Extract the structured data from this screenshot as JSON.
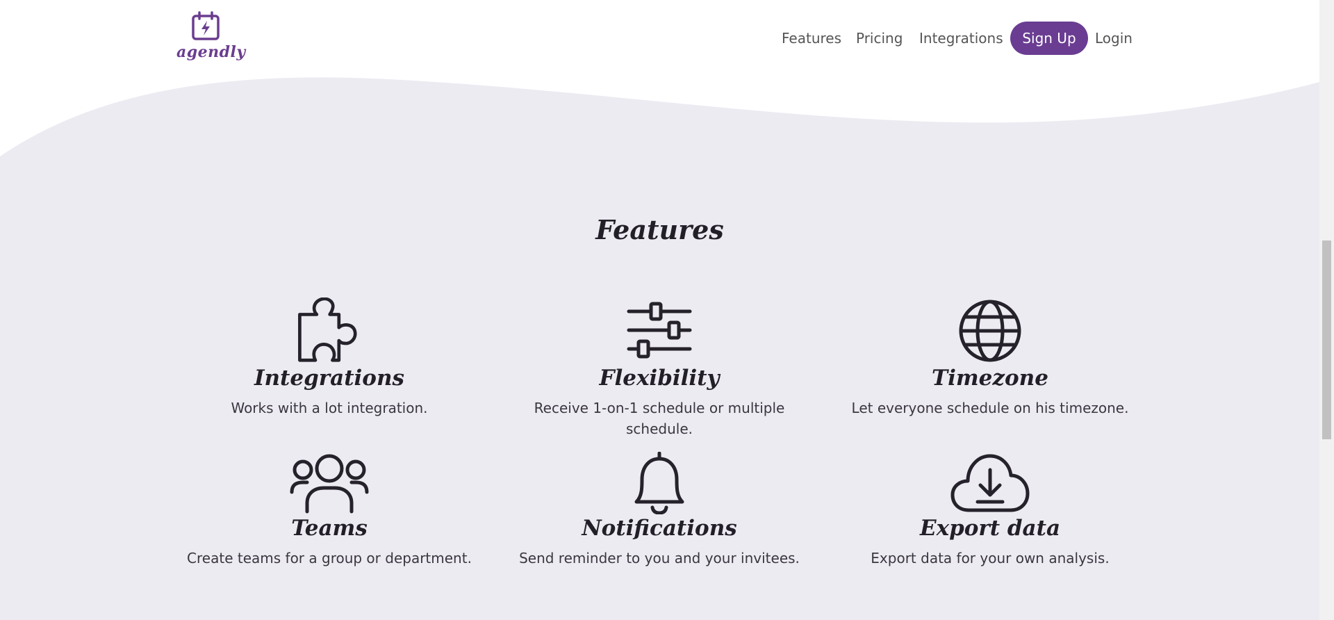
{
  "brand": {
    "name": "agendly",
    "logo_icon": "calendar-bolt-icon",
    "color": "#6a3d92"
  },
  "nav": {
    "links": [
      "Features",
      "Pricing",
      "Integrations"
    ],
    "signup_label": "Sign Up",
    "login_label": "Login"
  },
  "features_section": {
    "title": "Features",
    "items": [
      {
        "icon": "puzzle-icon",
        "title": "Integrations",
        "description": "Works with a lot integration."
      },
      {
        "icon": "sliders-icon",
        "title": "Flexibility",
        "description": "Receive 1-on-1 schedule or multiple schedule."
      },
      {
        "icon": "globe-icon",
        "title": "Timezone",
        "description": "Let everyone schedule on his timezone."
      },
      {
        "icon": "users-icon",
        "title": "Teams",
        "description": "Create teams for a group or department."
      },
      {
        "icon": "bell-icon",
        "title": "Notifications",
        "description": "Send reminder to you and your invitees."
      },
      {
        "icon": "cloud-download-icon",
        "title": "Export data",
        "description": "Export data for your own analysis."
      }
    ]
  },
  "colors": {
    "accent": "#6a3d92",
    "background": "#edebf2",
    "header": "#ffffff",
    "text": "#231f29"
  }
}
